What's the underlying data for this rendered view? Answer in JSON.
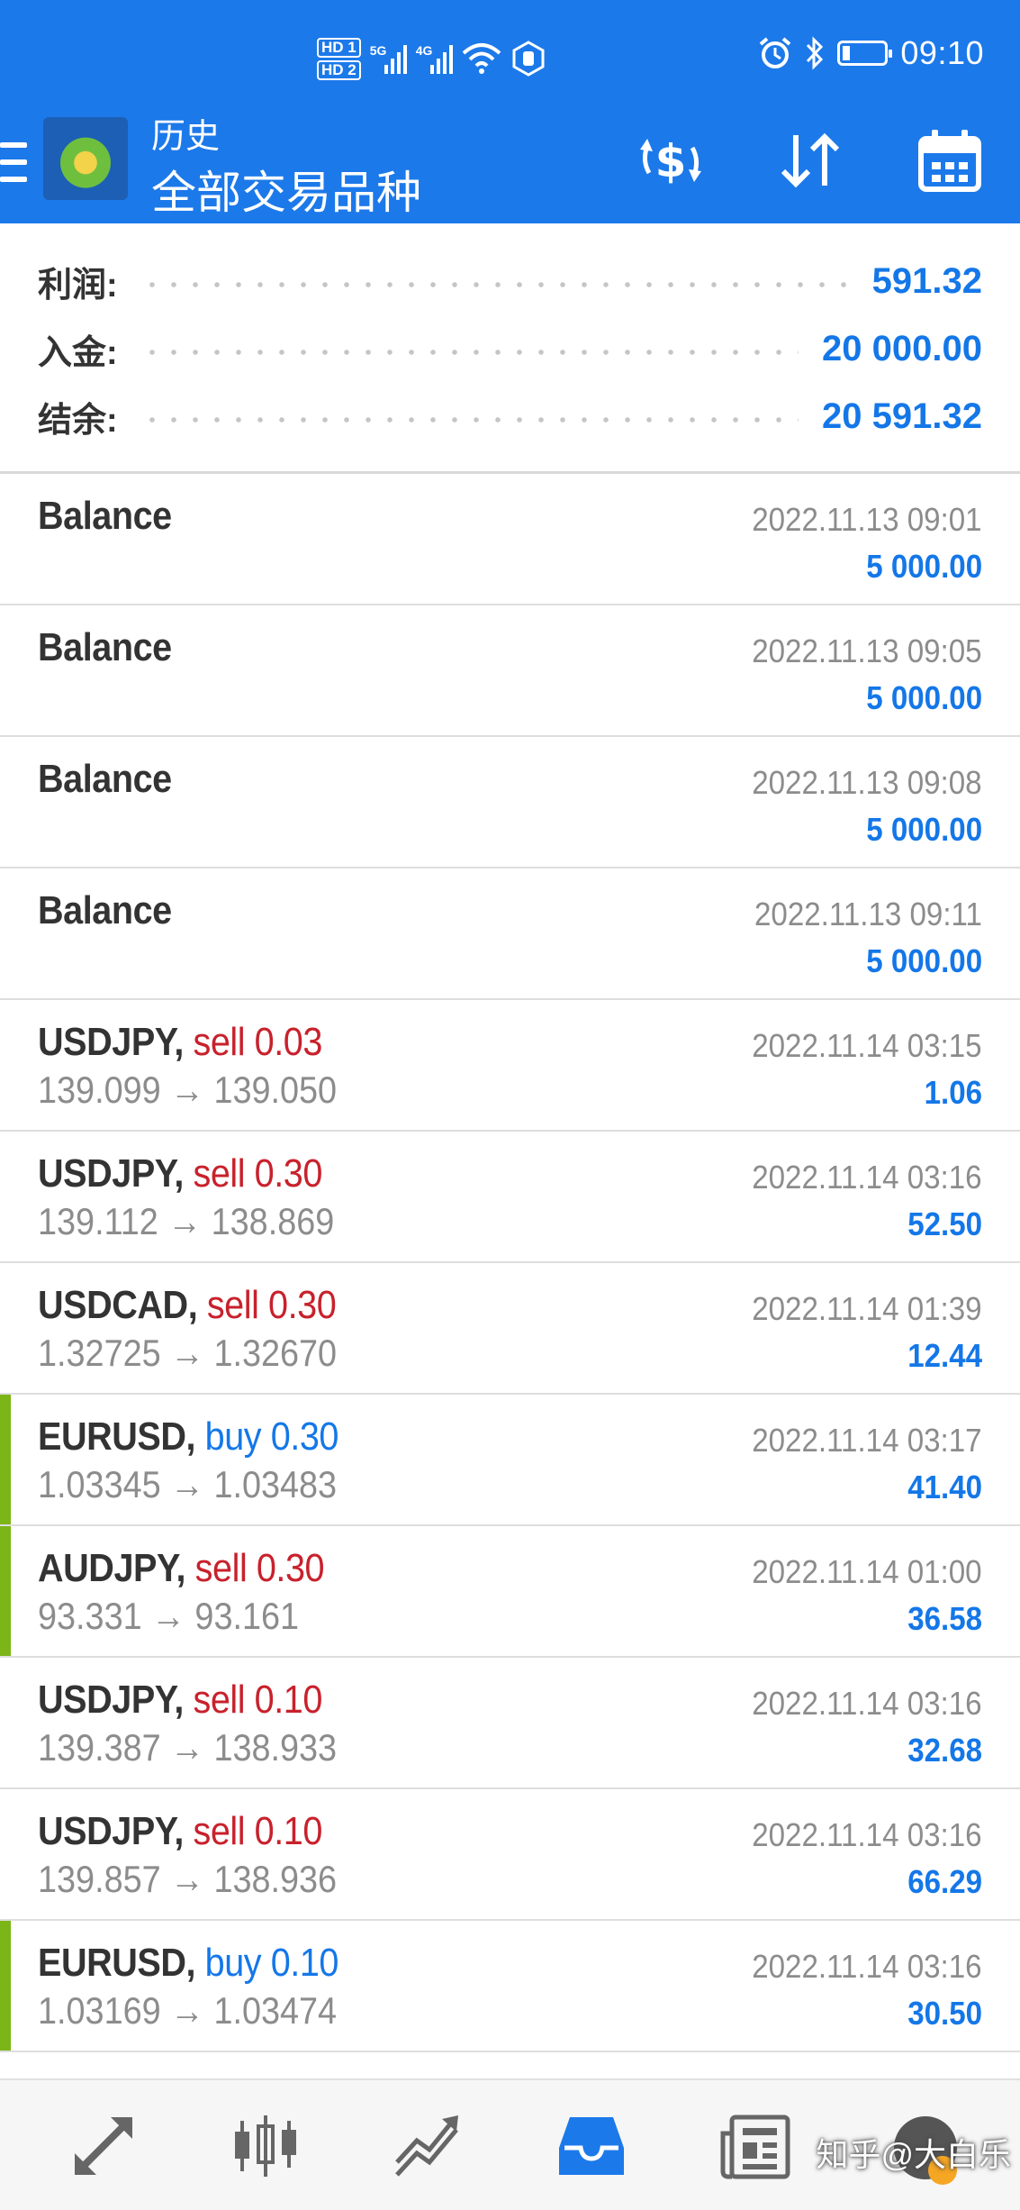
{
  "status_bar": {
    "hd1": "HD 1",
    "hd2": "HD 2",
    "net1": "5G",
    "net2": "4G",
    "time": "09:10"
  },
  "header": {
    "section": "历史",
    "filter": "全部交易品种"
  },
  "summary": [
    {
      "label": "利润:",
      "value": "591.32"
    },
    {
      "label": "入金:",
      "value": "20 000.00"
    },
    {
      "label": "结余:",
      "value": "20 591.32"
    }
  ],
  "history": [
    {
      "symbol": "Balance",
      "time": "2022.11.13 09:01",
      "profit": "5 000.00"
    },
    {
      "symbol": "Balance",
      "time": "2022.11.13 09:05",
      "profit": "5 000.00"
    },
    {
      "symbol": "Balance",
      "time": "2022.11.13 09:08",
      "profit": "5 000.00"
    },
    {
      "symbol": "Balance",
      "time": "2022.11.13 09:11",
      "profit": "5 000.00"
    },
    {
      "symbol": "USDJPY,",
      "side": "sell 0.03",
      "prices": "139.099 → 139.050",
      "time": "2022.11.14 03:15",
      "profit": "1.06"
    },
    {
      "symbol": "USDJPY,",
      "side": "sell 0.30",
      "prices": "139.112 → 138.869",
      "time": "2022.11.14 03:16",
      "profit": "52.50"
    },
    {
      "symbol": "USDCAD,",
      "side": "sell 0.30",
      "prices": "1.32725 → 1.32670",
      "time": "2022.11.14 01:39",
      "profit": "12.44"
    },
    {
      "symbol": "EURUSD,",
      "side": "buy 0.30",
      "prices": "1.03345 → 1.03483",
      "time": "2022.11.14 03:17",
      "profit": "41.40"
    },
    {
      "symbol": "AUDJPY,",
      "side": "sell 0.30",
      "prices": "93.331 → 93.161",
      "time": "2022.11.14 01:00",
      "profit": "36.58"
    },
    {
      "symbol": "USDJPY,",
      "side": "sell 0.10",
      "prices": "139.387 → 138.933",
      "time": "2022.11.14 03:16",
      "profit": "32.68"
    },
    {
      "symbol": "USDJPY,",
      "side": "sell 0.10",
      "prices": "139.857 → 138.936",
      "time": "2022.11.14 03:16",
      "profit": "66.29"
    },
    {
      "symbol": "EURUSD,",
      "side": "buy 0.10",
      "prices": "1.03169 → 1.03474",
      "time": "2022.11.14 03:16",
      "profit": "30.50"
    }
  ],
  "bottom_nav": {
    "icons": [
      "quotes-icon",
      "chart-icon",
      "trade-icon",
      "history-icon",
      "news-icon"
    ]
  },
  "watermark": "知乎@大白乐",
  "colors": {
    "header_bg": "#1c79ea",
    "profit_blue": "#1477e8",
    "sell_red": "#c8212c",
    "buy_accent": "#7cb518"
  }
}
